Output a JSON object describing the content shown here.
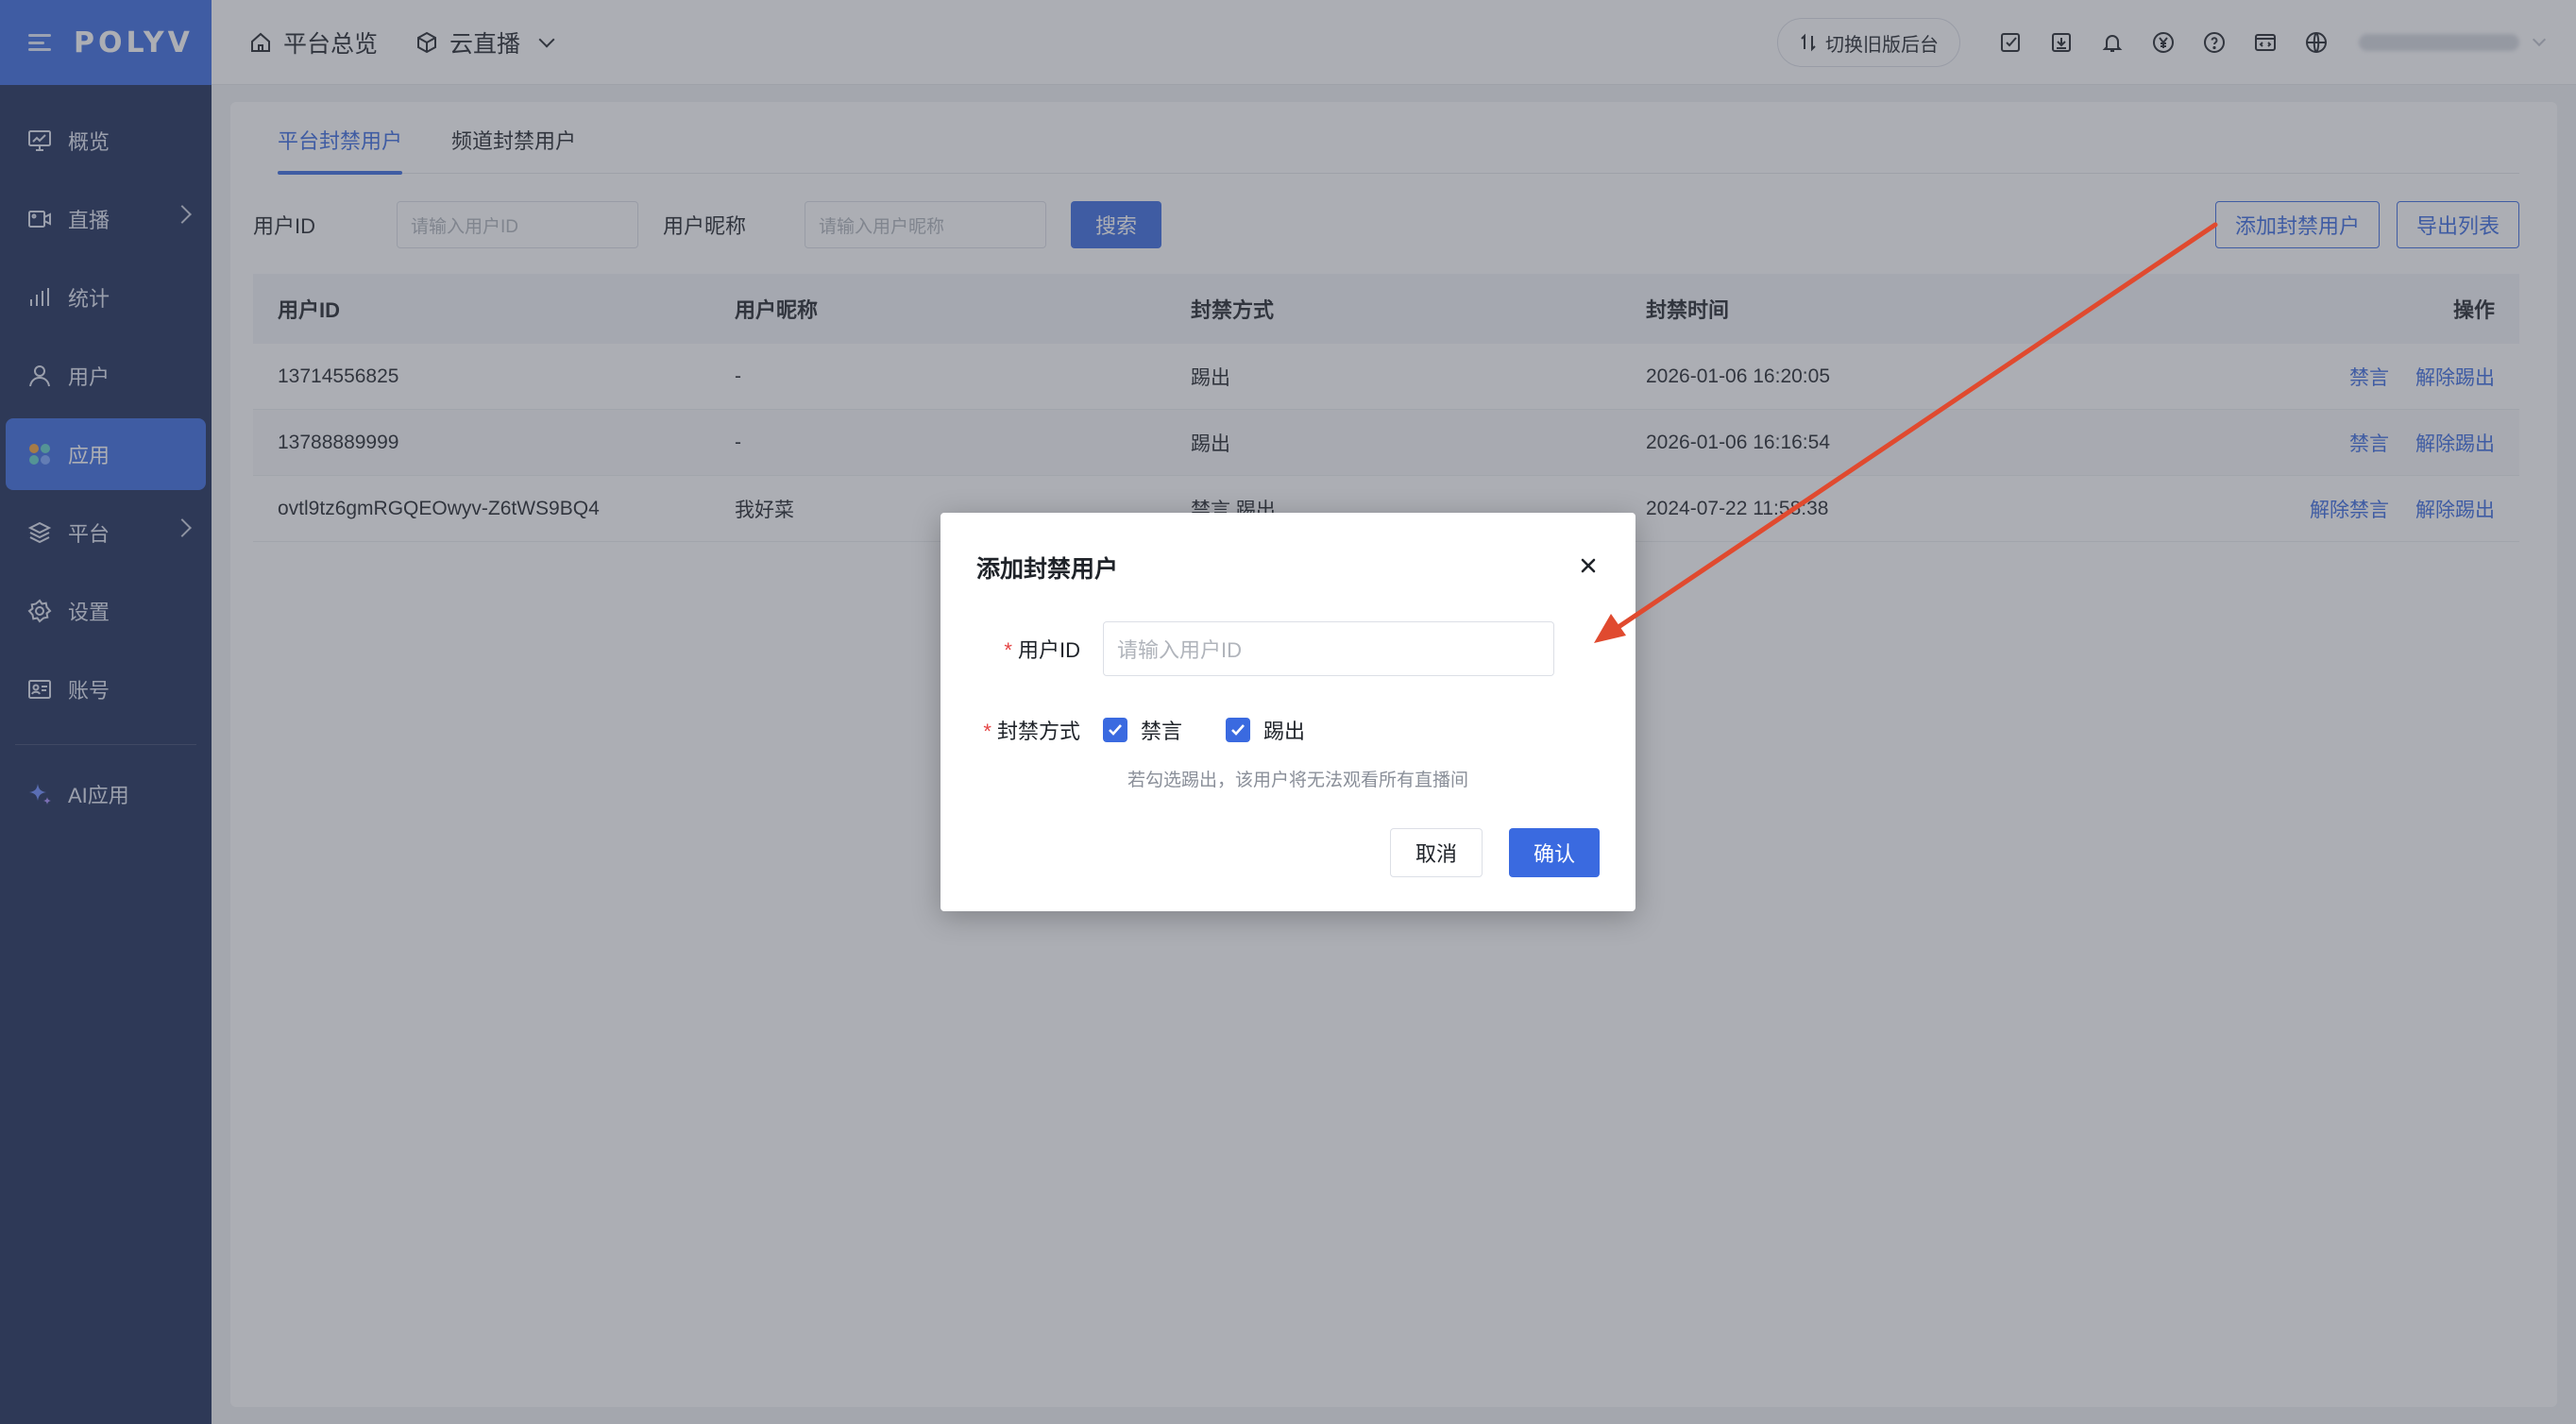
{
  "app": {
    "logo": "POLYV"
  },
  "sidebar": {
    "items": [
      {
        "label": "概览"
      },
      {
        "label": "直播"
      },
      {
        "label": "统计"
      },
      {
        "label": "用户"
      },
      {
        "label": "应用"
      },
      {
        "label": "平台"
      },
      {
        "label": "设置"
      },
      {
        "label": "账号"
      },
      {
        "label": "AI应用"
      }
    ]
  },
  "header": {
    "crumb_home": "平台总览",
    "crumb_product": "云直播",
    "switch_label": "切换旧版后台"
  },
  "tabs": [
    {
      "label": "平台封禁用户"
    },
    {
      "label": "频道封禁用户"
    }
  ],
  "filter": {
    "user_id_label": "用户ID",
    "user_id_placeholder": "请输入用户ID",
    "nickname_label": "用户昵称",
    "nickname_placeholder": "请输入用户昵称",
    "search_label": "搜索",
    "add_label": "添加封禁用户",
    "export_label": "导出列表"
  },
  "table": {
    "headers": [
      "用户ID",
      "用户昵称",
      "封禁方式",
      "封禁时间",
      "操作"
    ],
    "rows": [
      {
        "user_id": "13714556825",
        "nickname": "-",
        "method": "踢出",
        "time": "2026-01-06 16:20:05",
        "op1": "禁言",
        "op2": "解除踢出"
      },
      {
        "user_id": "13788889999",
        "nickname": "-",
        "method": "踢出",
        "time": "2026-01-06 16:16:54",
        "op1": "禁言",
        "op2": "解除踢出"
      },
      {
        "user_id": "ovtl9tz6gmRGQEOwyv-Z6tWS9BQ4",
        "nickname": "我好菜",
        "method": "禁言,踢出",
        "time": "2024-07-22 11:58:38",
        "op1": "解除禁言",
        "op2": "解除踢出"
      }
    ]
  },
  "dialog": {
    "title": "添加封禁用户",
    "required_mark": "*",
    "user_id_label": "用户ID",
    "user_id_placeholder": "请输入用户ID",
    "method_label": "封禁方式",
    "option_mute": "禁言",
    "option_kick": "踢出",
    "hint": "若勾选踢出，该用户将无法观看所有直播间",
    "cancel_label": "取消",
    "confirm_label": "确认"
  },
  "colors": {
    "accent": "#3a6ae0",
    "sidebar": "#1b2a57",
    "annotation_arrow": "#e04a2f"
  }
}
